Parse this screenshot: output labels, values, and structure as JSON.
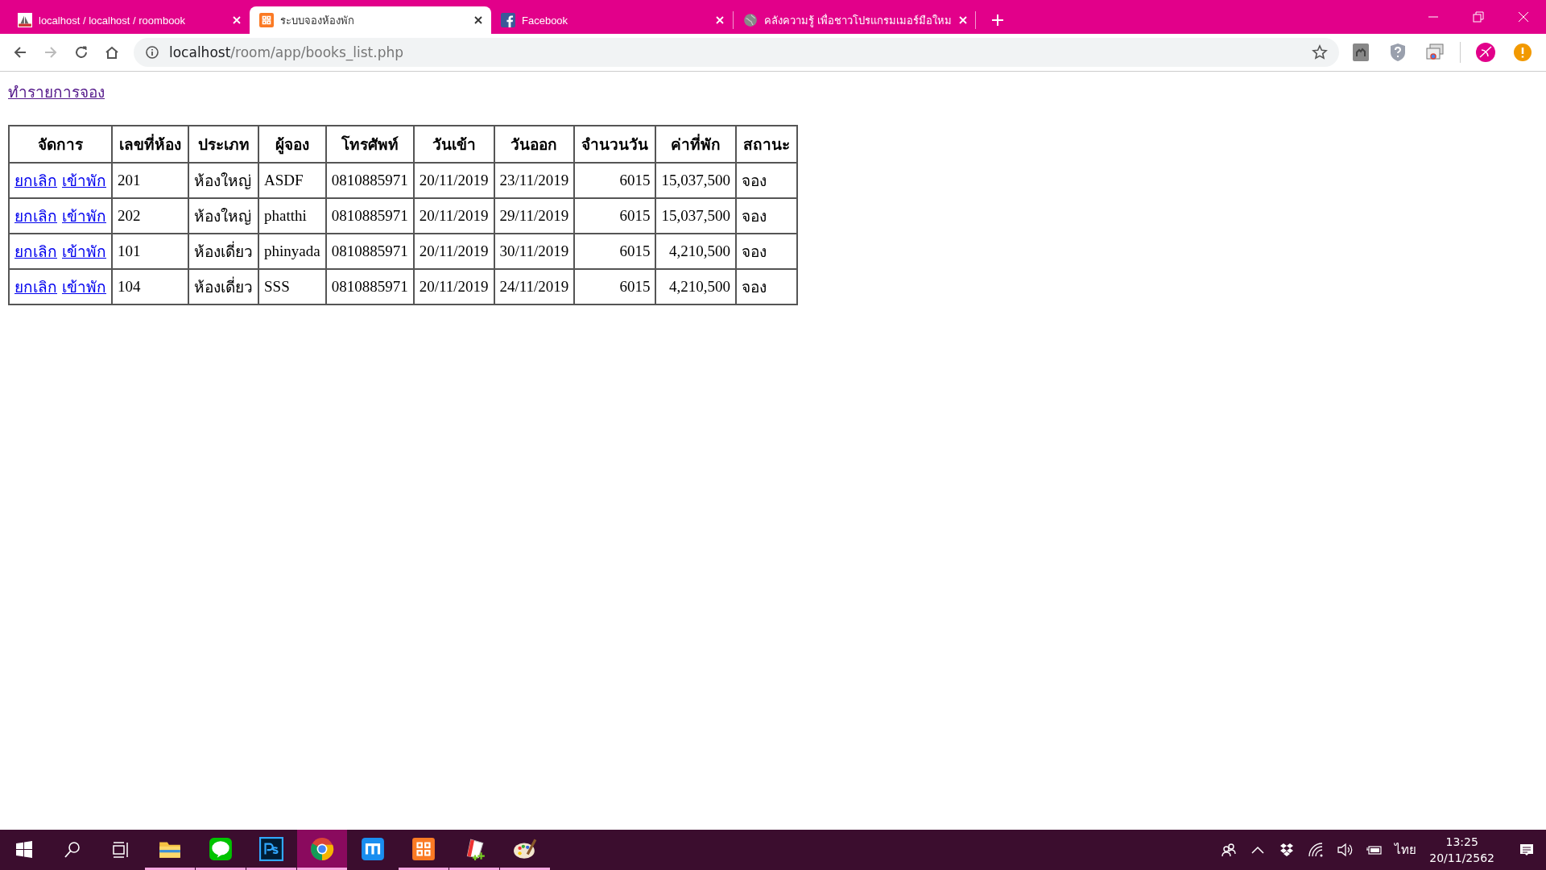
{
  "browser": {
    "tabs": [
      {
        "title": "localhost / localhost / roombook",
        "kind": "pma",
        "selected": false
      },
      {
        "title": "ระบบจองห้องพัก",
        "kind": "xampp",
        "selected": true
      },
      {
        "title": "Facebook",
        "kind": "facebook",
        "selected": false
      },
      {
        "title": "คลังความรู้ เพื่อชาวโปรแกรมเมอร์มือใหม",
        "kind": "globe",
        "selected": false
      }
    ],
    "address": {
      "host": "localhost",
      "path": "/room/app/books_list.php"
    }
  },
  "page": {
    "link": {
      "text": "ทำรายการจอง",
      "visited": true
    },
    "table": {
      "columns": [
        "จัดการ",
        "เลขที่ห้อง",
        "ประเภท",
        "ผู้จอง",
        "โทรศัพท์",
        "วันเข้า",
        "วันออก",
        "จำนวนวัน",
        "ค่าที่พัก",
        "สถานะ"
      ],
      "rows": [
        {
          "cells": [
            [
              "ยกเลิก",
              "เข้าพัก"
            ],
            "201",
            "ห้องใหญ่",
            "ASDF",
            "0810885971",
            "20/11/2019",
            "23/11/2019",
            "6015",
            "15,037,500",
            "จอง"
          ]
        },
        {
          "cells": [
            [
              "ยกเลิก",
              "เข้าพัก"
            ],
            "202",
            "ห้องใหญ่",
            "phatthi",
            "0810885971",
            "20/11/2019",
            "29/11/2019",
            "6015",
            "15,037,500",
            "จอง"
          ]
        },
        {
          "cells": [
            [
              "ยกเลิก",
              "เข้าพัก"
            ],
            "101",
            "ห้องเดี่ยว",
            "phinyada",
            "0810885971",
            "20/11/2019",
            "30/11/2019",
            "6015",
            "4,210,500",
            "จอง"
          ]
        },
        {
          "cells": [
            [
              "ยกเลิก",
              "เข้าพัก"
            ],
            "104",
            "ห้องเดี่ยว",
            "SSS",
            "0810885971",
            "20/11/2019",
            "24/11/2019",
            "6015",
            "4,210,500",
            "จอง"
          ]
        }
      ]
    }
  },
  "taskbar": {
    "apps": [
      {
        "kind": "folder",
        "running": true,
        "selected": false
      },
      {
        "kind": "chat",
        "running": true,
        "selected": false
      },
      {
        "kind": "ps",
        "running": true,
        "selected": false
      },
      {
        "kind": "chrome",
        "running": true,
        "selected": true
      },
      {
        "kind": "maxthon",
        "running": false,
        "selected": false
      },
      {
        "kind": "xampp",
        "running": true,
        "selected": false
      },
      {
        "kind": "notepad",
        "running": true,
        "selected": false
      },
      {
        "kind": "paint",
        "running": true,
        "selected": false
      }
    ],
    "language": "ไทย",
    "time": "13:25",
    "date": "20/11/2562"
  }
}
